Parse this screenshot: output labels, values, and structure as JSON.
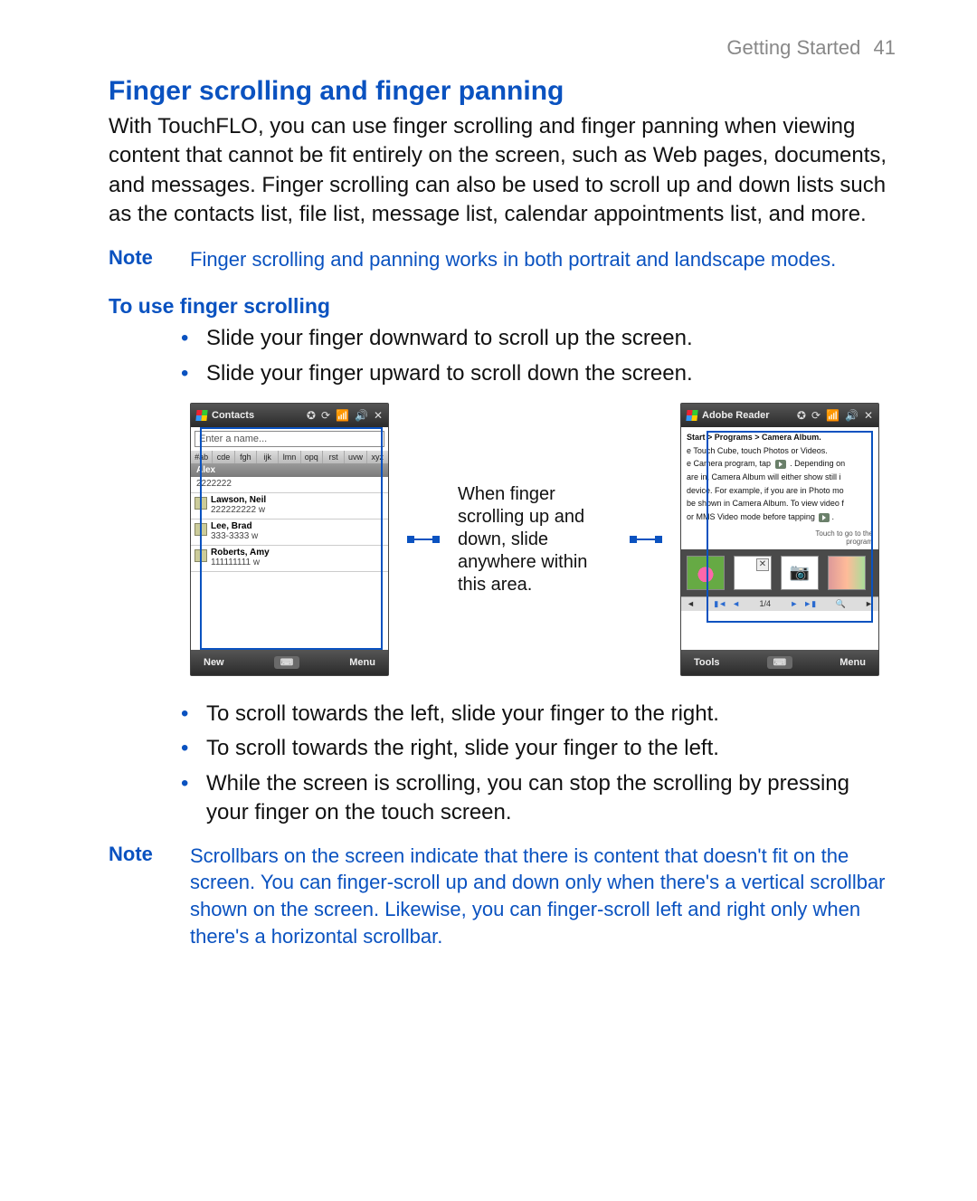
{
  "running_head": {
    "section": "Getting Started",
    "page": "41"
  },
  "title": "Finger scrolling and finger panning",
  "intro": "With TouchFLO, you can use finger scrolling and finger panning when viewing content that cannot be fit entirely on the screen, such as Web pages, documents, and messages. Finger scrolling can also be used to scroll up and down lists such as the contacts list, file list, message list, calendar appointments list, and more.",
  "note1": {
    "label": "Note",
    "text": "Finger scrolling and panning works in both portrait and landscape modes."
  },
  "subhead": "To use finger scrolling",
  "bullets_a": [
    "Slide your finger downward to scroll up the screen.",
    "Slide your finger upward to scroll down the screen."
  ],
  "figure": {
    "caption": "When finger scrolling up and down, slide anywhere within this area.",
    "contacts": {
      "app_title": "Contacts",
      "search_placeholder": "Enter a name...",
      "tabs": [
        "#ab",
        "cde",
        "fgh",
        "ijk",
        "lmn",
        "opq",
        "rst",
        "uvw",
        "xyz"
      ],
      "rows": [
        {
          "name": "Alex",
          "num": "2222222",
          "header": true
        },
        {
          "name": "Lawson, Neil",
          "num": "222222222  w"
        },
        {
          "name": "Lee, Brad",
          "num": "333-3333  w"
        },
        {
          "name": "Roberts, Amy",
          "num": "111111111  w"
        }
      ],
      "soft_left": "New",
      "soft_right": "Menu"
    },
    "reader": {
      "app_title": "Adobe Reader",
      "crumb": "Start > Programs > Camera Album.",
      "l1": "e Touch Cube, touch Photos or Videos.",
      "l2": "e Camera program, tap",
      "l2b": ". Depending on",
      "l3": "are in, Camera Album will either show still i",
      "l4": "device. For example, if you are in Photo mo",
      "l5": "be shown in Camera Album. To view video f",
      "l6": "or MMS Video mode before tapping",
      "hint": "Touch to go to the\nprogram",
      "pager_text": "1/4",
      "soft_left": "Tools",
      "soft_right": "Menu"
    }
  },
  "bullets_b": [
    "To scroll towards the left, slide your finger to the right.",
    "To scroll towards the right, slide your finger to the left.",
    "While the screen is scrolling, you can stop the scrolling by pressing your finger on the touch screen."
  ],
  "note2": {
    "label": "Note",
    "text": "Scrollbars on the screen indicate that there is content that doesn't fit on the screen. You can finger-scroll up and down only when there's a vertical scrollbar shown on the screen. Likewise, you can finger-scroll left and right only when there's a horizontal scrollbar."
  }
}
